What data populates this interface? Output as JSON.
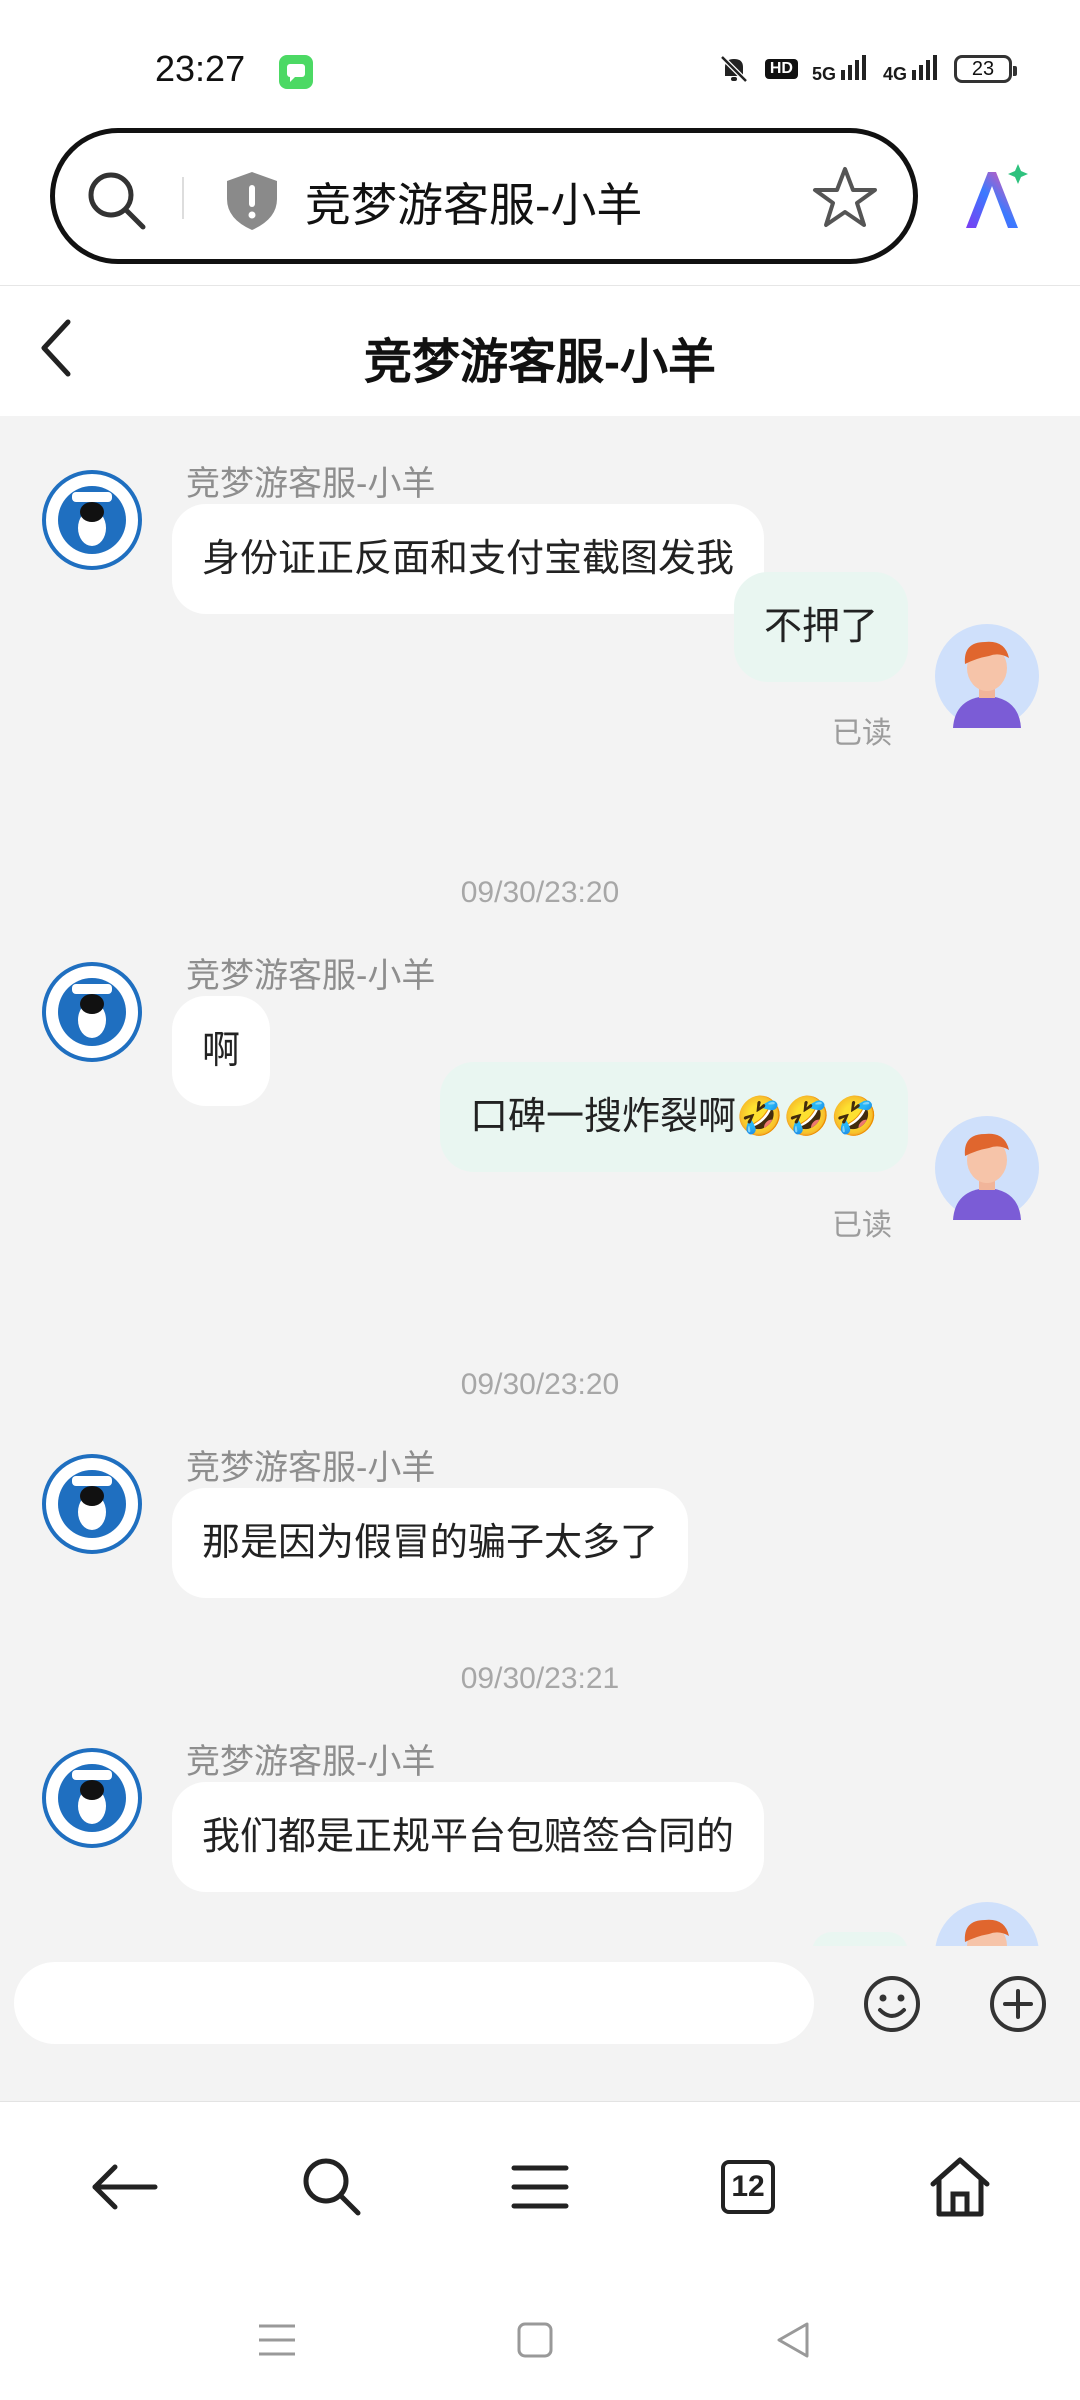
{
  "status_bar": {
    "time": "23:27",
    "network_1": "5G",
    "network_2": "4G",
    "hd_badge": "HD",
    "battery": "23"
  },
  "address_bar": {
    "url_text": "竞梦游客服-小羊"
  },
  "chat_header": {
    "title": "竞梦游客服-小羊"
  },
  "messages": [
    {
      "type": "incoming",
      "sender": "竞梦游客服-小羊",
      "text": "身份证正反面和支付宝截图发我"
    },
    {
      "type": "outgoing",
      "text": "不押了",
      "status": "已读"
    },
    {
      "type": "timestamp",
      "text": "09/30/23:20"
    },
    {
      "type": "incoming",
      "sender": "竞梦游客服-小羊",
      "text": "啊"
    },
    {
      "type": "outgoing",
      "text": "口碑一搜炸裂啊🤣🤣🤣",
      "status": "已读"
    },
    {
      "type": "timestamp",
      "text": "09/30/23:20"
    },
    {
      "type": "incoming",
      "sender": "竞梦游客服-小羊",
      "text": "那是因为假冒的骗子太多了"
    },
    {
      "type": "timestamp",
      "text": "09/30/23:21"
    },
    {
      "type": "incoming",
      "sender": "竞梦游客服-小羊",
      "text": "我们都是正规平台包赔签合同的"
    }
  ],
  "input": {
    "placeholder": ""
  },
  "toolbar": {
    "tab_count": "12"
  },
  "colors": {
    "chat_bg": "#f3f3f3",
    "outgoing_bubble": "#e9f6f1",
    "incoming_bubble": "#ffffff",
    "agent_logo_blue": "#1f6fc0"
  }
}
